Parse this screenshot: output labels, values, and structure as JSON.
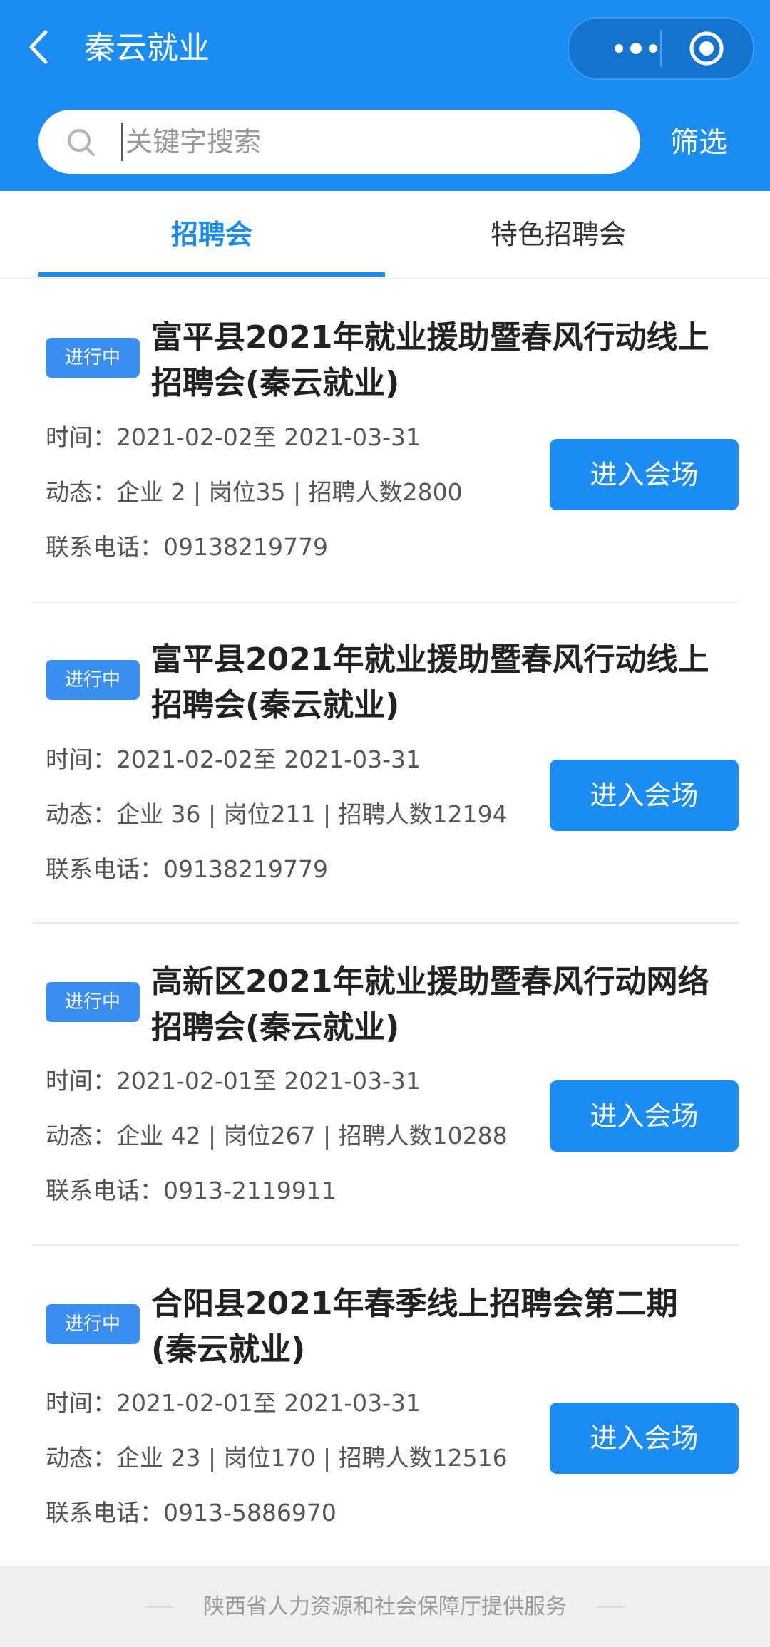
{
  "header": {
    "title": "秦云就业",
    "back_icon": "back-arrow-icon",
    "more_icon": "more-dots-icon",
    "close_icon": "close-target-icon",
    "bg_color": "#1a8cf2"
  },
  "search": {
    "placeholder": "关键字搜索",
    "value": "",
    "filter_label": "筛选"
  },
  "tabs": [
    {
      "label": "招聘会",
      "active": true
    },
    {
      "label": "特色招聘会",
      "active": false
    }
  ],
  "fairs": [
    {
      "status": "进行中",
      "title": "富平县2021年就业援助暨春风行动线上招聘会(秦云就业)",
      "time": "时间：2021-02-02至 2021-03-31",
      "stats": "动态：企业 2 | 岗位35 | 招聘人数2800",
      "phone": "联系电话：09138219779",
      "button": "进入会场"
    },
    {
      "status": "进行中",
      "title": "富平县2021年就业援助暨春风行动线上招聘会(秦云就业)",
      "time": "时间：2021-02-02至 2021-03-31",
      "stats": "动态：企业 36 | 岗位211 | 招聘人数12194",
      "phone": "联系电话：09138219779",
      "button": "进入会场"
    },
    {
      "status": "进行中",
      "title": "高新区2021年就业援助暨春风行动网络招聘会(秦云就业)",
      "time": "时间：2021-02-01至 2021-03-31",
      "stats": "动态：企业 42 | 岗位267 | 招聘人数10288",
      "phone": "联系电话：0913-2119911",
      "button": "进入会场"
    },
    {
      "status": "进行中",
      "title": "合阳县2021年春季线上招聘会第二期(秦云就业)",
      "time": "时间：2021-02-01至 2021-03-31",
      "stats": "动态：企业 23 | 岗位170 | 招聘人数12516",
      "phone": "联系电话：0913-5886970",
      "button": "进入会场"
    }
  ],
  "footer": {
    "text": "陕西省人力资源和社会保障厅提供服务"
  }
}
